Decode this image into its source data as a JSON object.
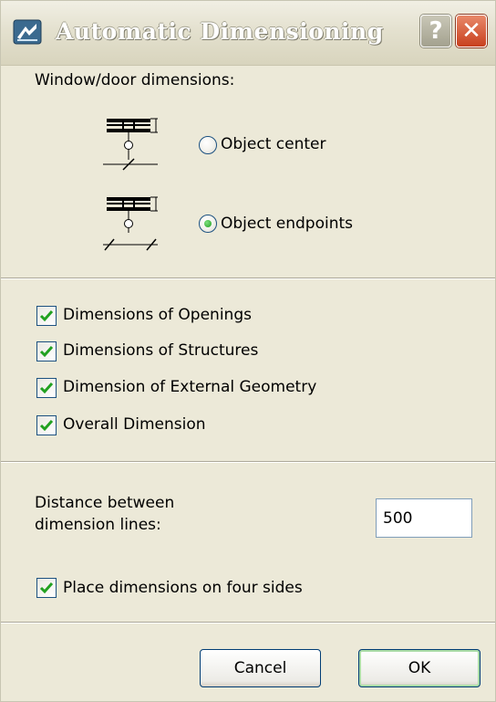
{
  "window": {
    "title": "Automatic Dimensioning",
    "help_label": "?",
    "close_label": "✕"
  },
  "window_door": {
    "heading": "Window/door dimensions:",
    "options": [
      {
        "label": "Object center",
        "selected": false
      },
      {
        "label": "Object endpoints",
        "selected": true
      }
    ]
  },
  "checkboxes": [
    {
      "label": "Dimensions of Openings",
      "checked": true
    },
    {
      "label": "Dimensions of Structures",
      "checked": true
    },
    {
      "label": "Dimension of External Geometry",
      "checked": true
    },
    {
      "label": "Overall Dimension",
      "checked": true
    }
  ],
  "distance": {
    "label_line1": "Distance between",
    "label_line2": "dimension lines:",
    "value": "500"
  },
  "four_sides": {
    "label": "Place dimensions on four sides",
    "checked": true
  },
  "buttons": {
    "cancel": "Cancel",
    "ok": "OK"
  },
  "colors": {
    "accent_check": "#21a121",
    "titlebar": "#e4e1cf"
  }
}
